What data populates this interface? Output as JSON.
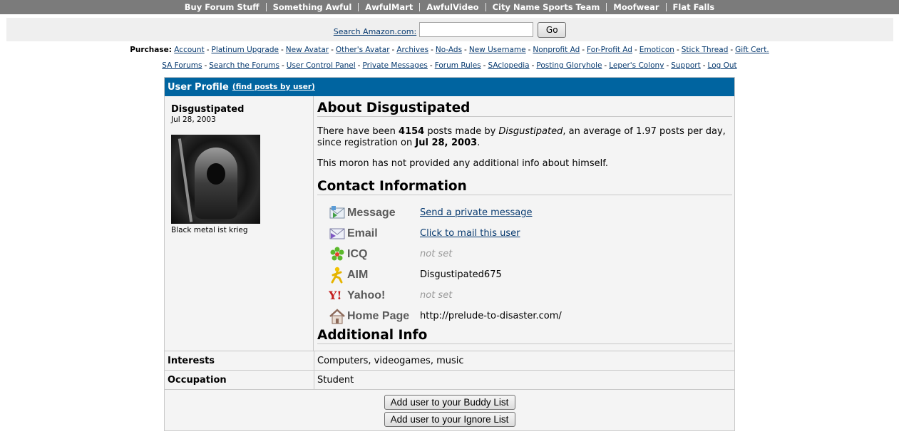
{
  "topnav": {
    "items": [
      "Buy Forum Stuff",
      "Something Awful",
      "AwfulMart",
      "AwfulVideo",
      "City Name Sports Team",
      "Moofwear",
      "Flat Falls"
    ]
  },
  "amazon": {
    "label": "Search Amazon.com:",
    "input_value": "",
    "go_label": "Go"
  },
  "purchase": {
    "label": "Purchase:",
    "links": [
      "Account",
      "Platinum Upgrade",
      "New Avatar",
      "Other's Avatar",
      "Archives",
      "No-Ads",
      "New Username",
      "Nonprofit Ad",
      "For-Profit Ad",
      "Emoticon",
      "Stick Thread",
      "Gift Cert."
    ]
  },
  "forumlinks": {
    "links": [
      "SA Forums",
      "Search the Forums",
      "User Control Panel",
      "Private Messages",
      "Forum Rules",
      "SAclopedia",
      "Posting Gloryhole",
      "Leper's Colony",
      "Support",
      "Log Out"
    ]
  },
  "profile": {
    "header_title": "User Profile",
    "find_posts": "(find posts by user)",
    "username": "Disgustipated",
    "regdate": "Jul 28, 2003",
    "avatar_caption": "Black metal ist krieg",
    "about_title": "About Disgustipated",
    "about": {
      "p1_a": "There have been ",
      "posts": "4154",
      "p1_b": " posts made by ",
      "name": "Disgustipated",
      "p1_c": ", an average of 1.97 posts per day, since registration on ",
      "date": "Jul 28, 2003",
      "p1_d": ".",
      "p2": "This moron has not provided any additional info about himself."
    },
    "contact_title": "Contact Information",
    "contacts": [
      {
        "icon": "message-icon",
        "label": "Message",
        "value": "Send a private message",
        "kind": "link"
      },
      {
        "icon": "email-icon",
        "label": "Email",
        "value": "Click to mail this user",
        "kind": "link"
      },
      {
        "icon": "icq-flower-icon",
        "label": "ICQ",
        "value": "not set",
        "kind": "notset"
      },
      {
        "icon": "aim-running-man-icon",
        "label": "AIM",
        "value": "Disgustipated675",
        "kind": "text"
      },
      {
        "icon": "yahoo-icon",
        "label": "Yahoo!",
        "value": "not set",
        "kind": "notset"
      },
      {
        "icon": "home-icon",
        "label": "Home Page",
        "value": "http://prelude-to-disaster.com/",
        "kind": "text"
      }
    ],
    "additional_title": "Additional Info",
    "interests_label": "Interests",
    "interests_value": "Computers, videogames, music",
    "occupation_label": "Occupation",
    "occupation_value": "Student",
    "buddy_button": "Add user to your Buddy List",
    "ignore_button": "Add user to your Ignore List"
  },
  "colors": {
    "header_blue": "#0064a0",
    "topnav_gray": "#7b7b7b",
    "link_blue": "#06396f",
    "panel_bg": "#f4f4f4"
  }
}
